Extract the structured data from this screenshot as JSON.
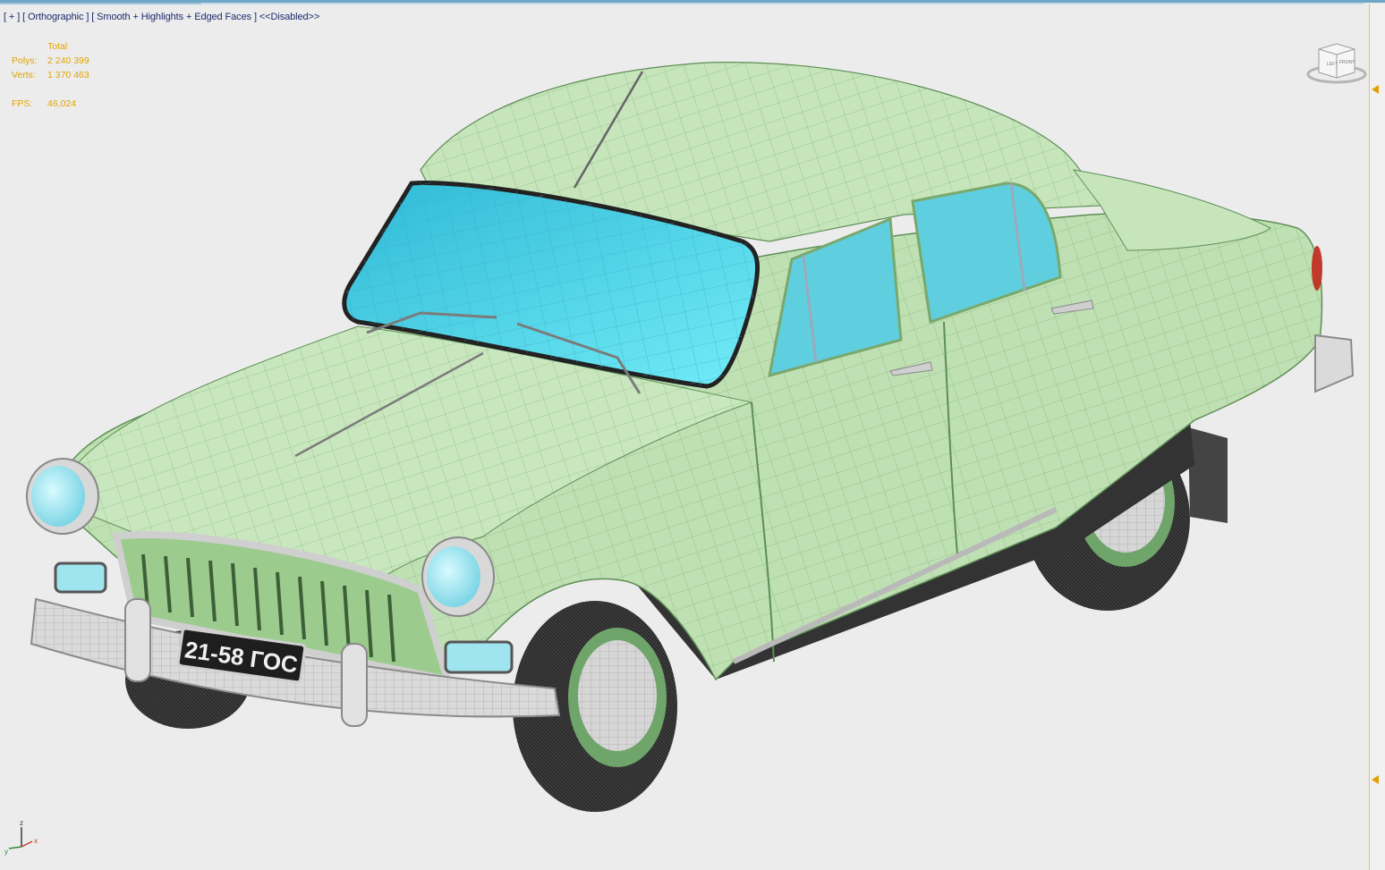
{
  "viewport": {
    "label": "[ + ] [ Orthographic ] [ Smooth + Highlights + Edged Faces ] <<Disabled>>"
  },
  "stats": {
    "header": "Total",
    "polys_label": "Polys:",
    "polys_value": "2 240 399",
    "verts_label": "Verts:",
    "verts_value": "1 370 463",
    "fps_label": "FPS:",
    "fps_value": "46,024"
  },
  "viewcube": {
    "left": "LEFT",
    "front": "FRONT"
  },
  "axis": {
    "z": "z",
    "x": "x",
    "y": "y"
  },
  "license_plate": "21-58 ГОС",
  "colors": {
    "body": "#bfe0b3",
    "glass": "#5fdcef",
    "chrome": "#d7d7d7",
    "tire": "#2c2c2c",
    "stats_text": "#e0a400",
    "label_text": "#1d2a6e"
  },
  "icons": [
    "viewcube-icon",
    "axis-tripod-icon"
  ]
}
